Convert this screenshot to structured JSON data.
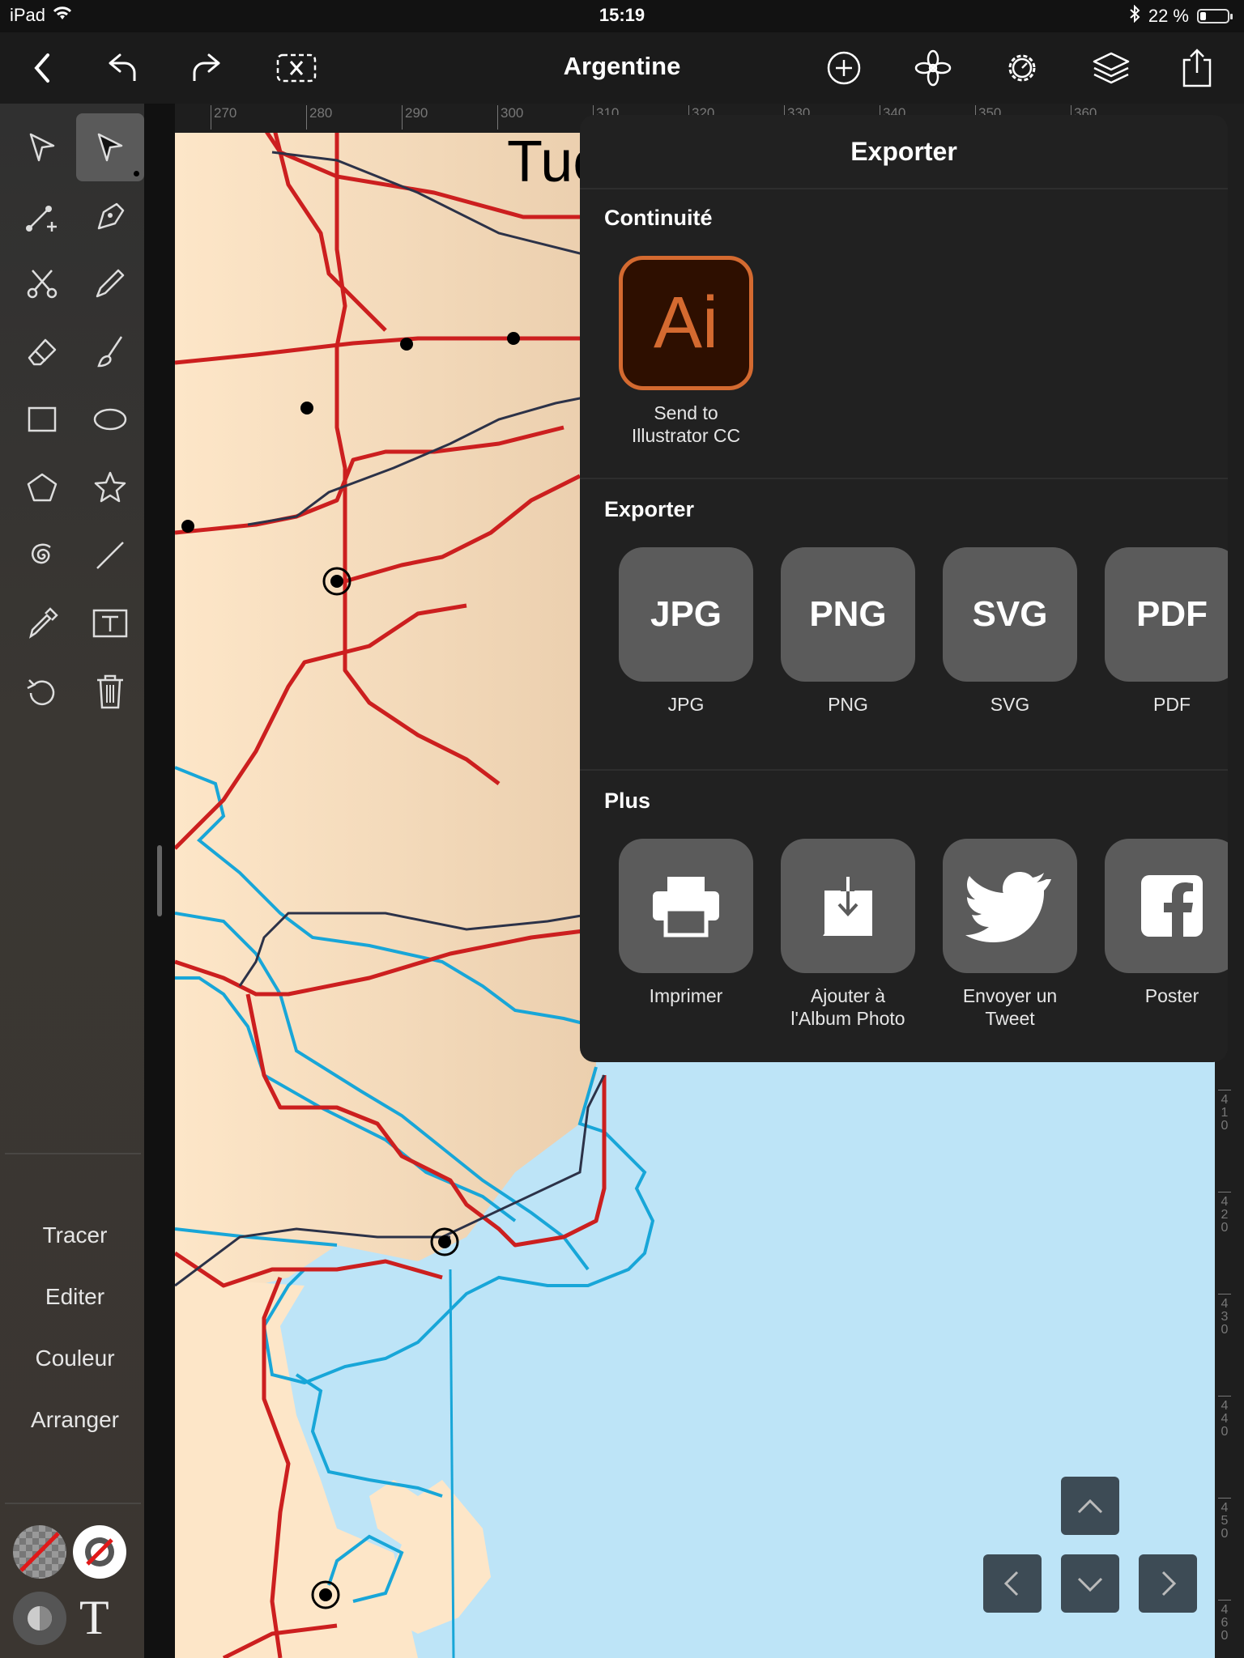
{
  "status_bar": {
    "device": "iPad",
    "time": "15:19",
    "battery_text": "22 %",
    "battery_level": 0.22
  },
  "toolbar": {
    "title": "Argentine"
  },
  "sidebar": {
    "labels": [
      "Tracer",
      "Editer",
      "Couleur",
      "Arranger"
    ]
  },
  "ruler": {
    "top_ticks": [
      "270",
      "280",
      "290",
      "300",
      "310",
      "320",
      "330",
      "340",
      "350",
      "360"
    ],
    "side_ticks": [
      "4\n1\n0",
      "4\n2\n0",
      "4\n3\n0",
      "4\n4\n0",
      "4\n5\n0",
      "4\n6\n0"
    ]
  },
  "map": {
    "city_label": "Tuc"
  },
  "export_panel": {
    "title": "Exporter",
    "continuity": {
      "title": "Continuité",
      "items": [
        {
          "badge": "Ai",
          "label_line1": "Send to",
          "label_line2": "Illustrator CC"
        }
      ]
    },
    "export": {
      "title": "Exporter",
      "items": [
        {
          "format": "JPG",
          "label": "JPG"
        },
        {
          "format": "PNG",
          "label": "PNG"
        },
        {
          "format": "SVG",
          "label": "SVG"
        },
        {
          "format": "PDF",
          "label": "PDF"
        }
      ]
    },
    "more": {
      "title": "Plus",
      "items": [
        {
          "icon": "printer-icon",
          "label_line1": "Imprimer",
          "label_line2": ""
        },
        {
          "icon": "save-to-photos-icon",
          "label_line1": "Ajouter à",
          "label_line2": "l'Album Photo"
        },
        {
          "icon": "twitter-icon",
          "label_line1": "Envoyer un Tweet",
          "label_line2": ""
        },
        {
          "icon": "facebook-icon",
          "label_line1": "Poster",
          "label_line2": ""
        }
      ]
    }
  },
  "colors": {
    "land": "#fde6c8",
    "water": "#bde4f7",
    "road": "#cc1f1f",
    "river": "#18a6d8",
    "rail": "#2c3248",
    "ai_accent": "#d46a30"
  }
}
